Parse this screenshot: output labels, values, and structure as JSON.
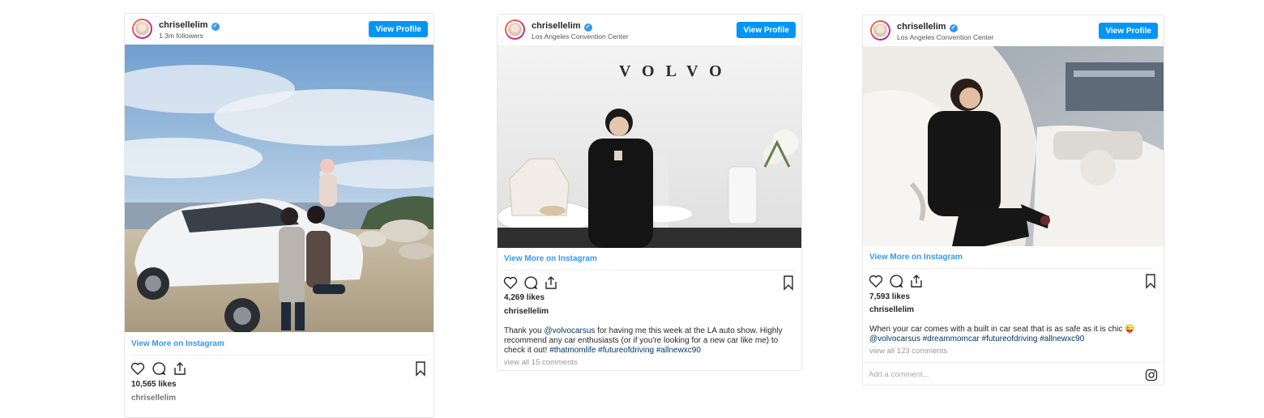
{
  "posts": [
    {
      "username": "chrisellelim",
      "subline": "1.3m followers",
      "view_profile": "View Profile",
      "view_more": "View More on Instagram",
      "likes": "10,565 likes",
      "author": "chrisellelim"
    },
    {
      "username": "chrisellelim",
      "subline": "Los Angeles Convention Center",
      "view_profile": "View Profile",
      "photo_sign": "VOLVO",
      "view_more": "View More on Instagram",
      "likes": "4,269 likes",
      "author": "chrisellelim",
      "caption_pre": "Thank you ",
      "caption_mention": "@volvocarsus",
      "caption_mid": " for having me this week at the LA auto show. Highly recommend any car enthusiasts (or if you're looking for a new car like me) to check it out! ",
      "caption_tags": "#thatmomlife #futureofdriving #allnewxc90",
      "view_all": "view all 15 comments"
    },
    {
      "username": "chrisellelim",
      "subline": "Los Angeles Convention Center",
      "view_profile": "View Profile",
      "view_more": "View More on Instagram",
      "likes": "7,593 likes",
      "author": "chrisellelim",
      "caption_pre": "When your car comes with a built in car seat that is as safe as it is chic 😜",
      "caption_mention": "@volvocarsus",
      "caption_tags": " #dreammomcar #futureofdriving #allnewxc90",
      "view_all": "view all 123 comments",
      "comment_placeholder": "Add a comment..."
    }
  ],
  "colors": {
    "accent": "#0095f6",
    "link": "#3897f0",
    "hashtag": "#003569"
  },
  "icons": [
    "verified-badge-icon",
    "heart-icon",
    "comment-icon",
    "share-icon",
    "bookmark-icon",
    "instagram-icon"
  ]
}
